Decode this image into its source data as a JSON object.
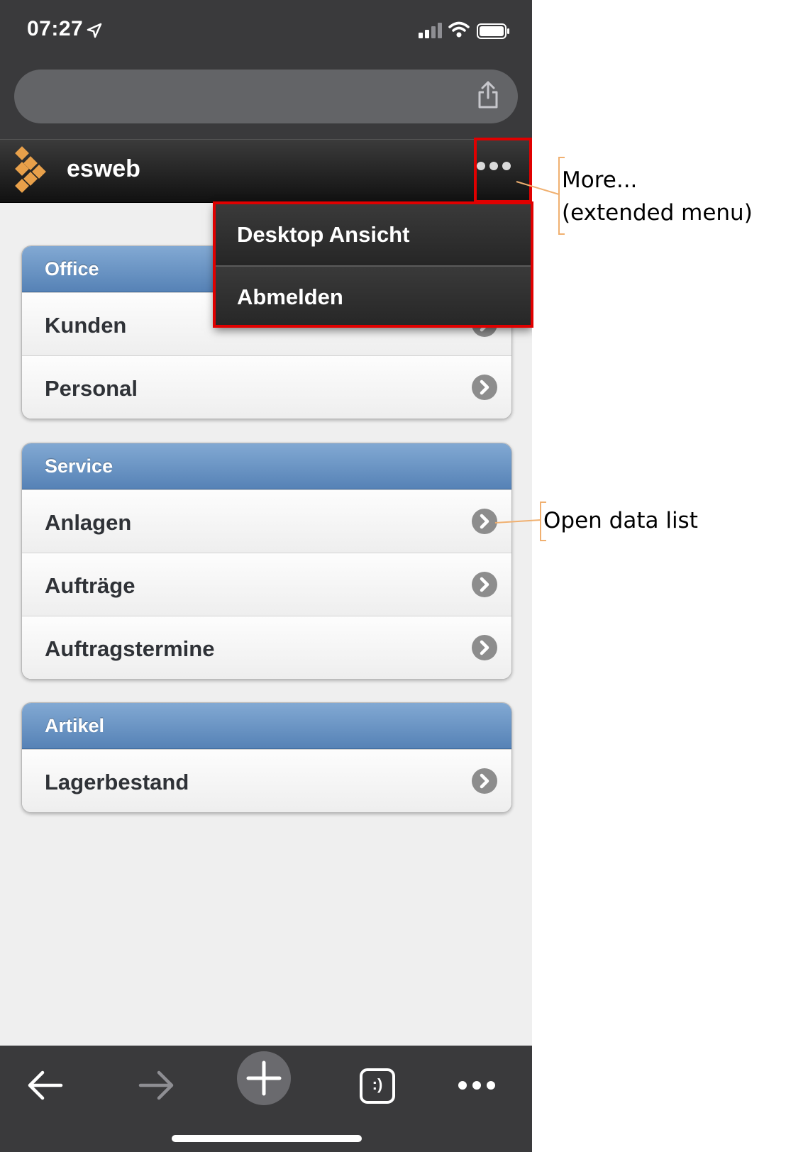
{
  "status_bar": {
    "time": "07:27"
  },
  "app": {
    "title": "esweb"
  },
  "dropdown_menu": [
    {
      "label": "Desktop Ansicht"
    },
    {
      "label": "Abmelden"
    }
  ],
  "groups": [
    {
      "header": "Office",
      "items": [
        "Kunden",
        "Personal"
      ]
    },
    {
      "header": "Service",
      "items": [
        "Anlagen",
        "Aufträge",
        "Auftragstermine"
      ]
    },
    {
      "header": "Artikel",
      "items": [
        "Lagerbestand"
      ]
    }
  ],
  "toolbar": {
    "tabs_label": ":)"
  },
  "annotations": {
    "more_line1": "More...",
    "more_line2": "(extended menu)",
    "open_list": "Open data list"
  },
  "colors": {
    "highlight": "#e00000",
    "annotation_line": "#f0b070",
    "group_header": "#6a93c5",
    "logo": "#e8a04a"
  },
  "icons": [
    "location-arrow-icon",
    "signal-icon",
    "wifi-icon",
    "battery-icon",
    "share-icon",
    "logo-icon",
    "more-dots-icon",
    "chevron-right-icon",
    "back-arrow-icon",
    "forward-arrow-icon",
    "new-tab-plus-icon",
    "tabs-icon",
    "browser-menu-icon"
  ]
}
